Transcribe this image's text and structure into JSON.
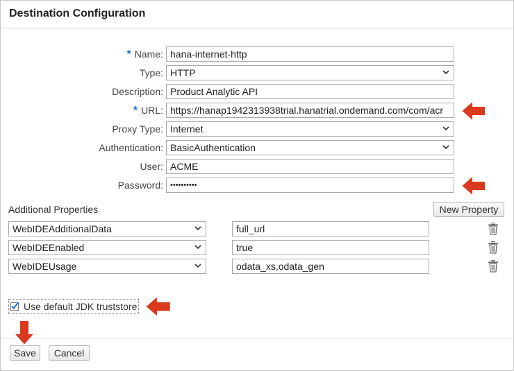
{
  "dialog": {
    "title": "Destination Configuration"
  },
  "form": {
    "name": {
      "label": "Name:",
      "required_mark": "*",
      "value": "hana-internet-http"
    },
    "type": {
      "label": "Type:",
      "value": "HTTP"
    },
    "description": {
      "label": "Description:",
      "value": "Product Analytic API"
    },
    "url": {
      "label": "URL:",
      "required_mark": "*",
      "value": "https://hanap1942313938trial.hanatrial.ondemand.com/com/acr"
    },
    "proxy_type": {
      "label": "Proxy Type:",
      "value": "Internet"
    },
    "authentication": {
      "label": "Authentication:",
      "value": "BasicAuthentication"
    },
    "user": {
      "label": "User:",
      "value": "ACME"
    },
    "password": {
      "label": "Password:",
      "value": "••••••••••"
    }
  },
  "additional_properties": {
    "label": "Additional Properties",
    "new_button": "New Property",
    "rows": [
      {
        "key": "WebIDEAdditionalData",
        "value": "full_url"
      },
      {
        "key": "WebIDEEnabled",
        "value": "true"
      },
      {
        "key": "WebIDEUsage",
        "value": "odata_xs,odata_gen"
      }
    ]
  },
  "truststore": {
    "label": "Use default JDK truststore",
    "checked": true
  },
  "footer": {
    "save": "Save",
    "cancel": "Cancel"
  },
  "colors": {
    "required": "#1a71c6",
    "arrow": "#d9391c",
    "checkmark": "#1f6fd1"
  }
}
